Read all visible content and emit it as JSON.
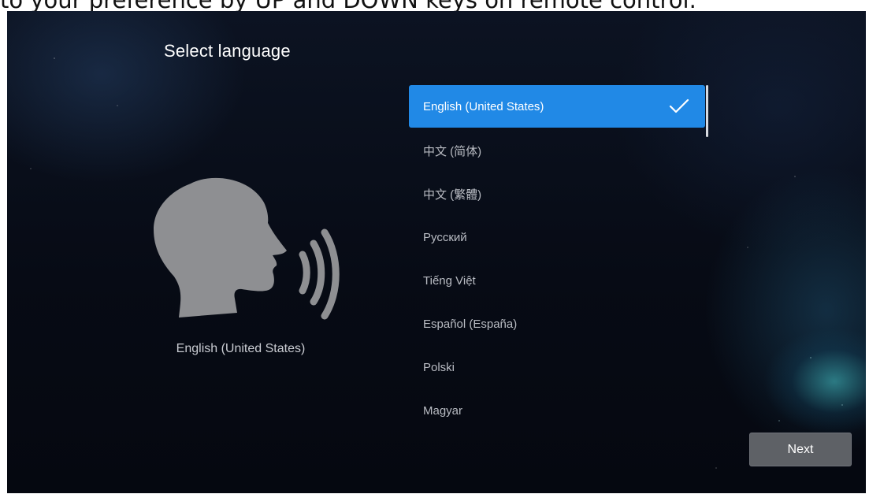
{
  "instruction_caption": "to your preference by UP and DOWN keys on remote control.",
  "header": {
    "title": "Select language"
  },
  "left_panel": {
    "icon": "speaking-head-icon",
    "current_language": "English (United States)"
  },
  "language_list": {
    "items": [
      {
        "label": "English (United States)",
        "selected": true
      },
      {
        "label": "中文 (简体)",
        "selected": false
      },
      {
        "label": "中文 (繁體)",
        "selected": false
      },
      {
        "label": "Русский",
        "selected": false
      },
      {
        "label": "Tiếng Việt",
        "selected": false
      },
      {
        "label": "Español (España)",
        "selected": false
      },
      {
        "label": "Polski",
        "selected": false
      },
      {
        "label": "Magyar",
        "selected": false
      }
    ],
    "selected_icon": "checkmark-icon"
  },
  "footer": {
    "next_label": "Next"
  },
  "colors": {
    "selection": "#2189e6",
    "background": "#070b15",
    "button": "#5e6166"
  }
}
